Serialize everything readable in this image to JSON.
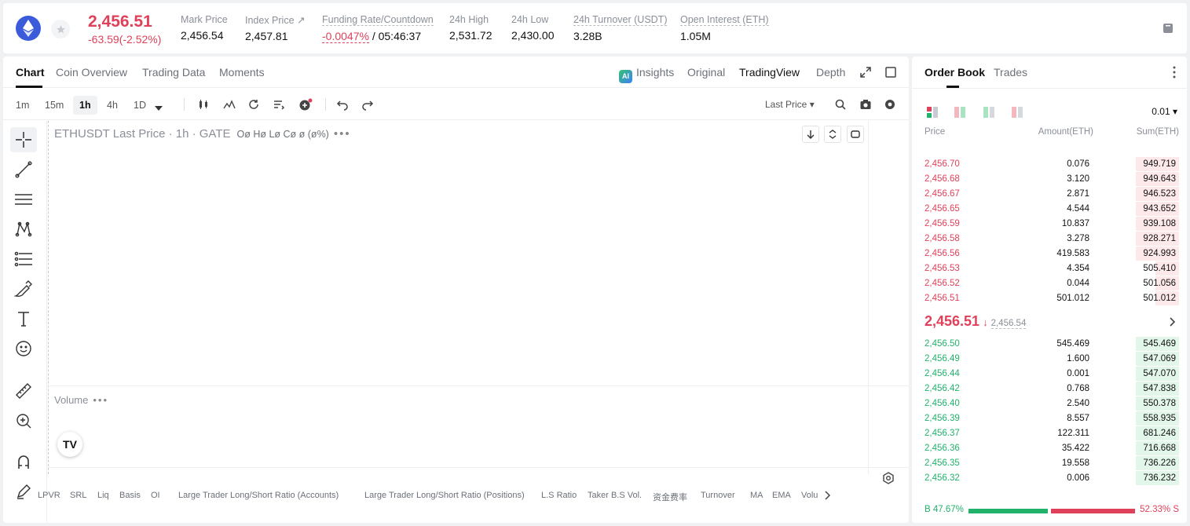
{
  "header": {
    "last_price": "2,456.51",
    "price_change": "-63.59(-2.52%)",
    "stats": [
      {
        "label": "Mark Price",
        "value": "2,456.54"
      },
      {
        "label": "Index Price ↗",
        "value": "2,457.81"
      },
      {
        "label": "Funding Rate/Countdown",
        "value": "-0.0047%",
        "countdown": "/ 05:46:37"
      },
      {
        "label": "24h High",
        "value": "2,531.72"
      },
      {
        "label": "24h Low",
        "value": "2,430.00"
      },
      {
        "label": "24h Turnover (USDT)",
        "value": "3.28B"
      },
      {
        "label": "Open Interest (ETH)",
        "value": "1.05M"
      }
    ]
  },
  "chart": {
    "tabs": [
      "Chart",
      "Coin Overview",
      "Trading Data",
      "Moments"
    ],
    "views": {
      "insights": "Insights",
      "ai_badge": "AI",
      "original": "Original",
      "tradingview": "TradingView",
      "depth": "Depth"
    },
    "intervals": [
      "1m",
      "15m",
      "1h",
      "4h",
      "1D"
    ],
    "price_source": "Last Price ▾",
    "legend": "ETHUSDT Last Price · 1h · GATE",
    "ohlc": "Oø Hø Lø Cø ø (ø%)",
    "dots": "•••",
    "volume_label": "Volume",
    "tv_logo": "TV",
    "indicators": [
      "LPVR",
      "SRL",
      "Liq",
      "Basis",
      "OI",
      "Large Trader Long/Short Ratio (Accounts)",
      "Large Trader Long/Short Ratio (Positions)",
      "L.S Ratio",
      "Taker B.S Vol.",
      "资金费率",
      "Turnover",
      "MA",
      "EMA",
      "Volu"
    ]
  },
  "orderbook": {
    "tabs": [
      "Order Book",
      "Trades"
    ],
    "precision": "0.01 ▾",
    "headers": {
      "price": "Price",
      "amount": "Amount(ETH)",
      "sum": "Sum(ETH)"
    },
    "asks": [
      {
        "price": "2,456.70",
        "amount": "0.076",
        "sum": "949.719",
        "depth": 0.55
      },
      {
        "price": "2,456.68",
        "amount": "3.120",
        "sum": "949.643",
        "depth": 0.55
      },
      {
        "price": "2,456.67",
        "amount": "2.871",
        "sum": "946.523",
        "depth": 0.55
      },
      {
        "price": "2,456.65",
        "amount": "4.544",
        "sum": "943.652",
        "depth": 0.55
      },
      {
        "price": "2,456.59",
        "amount": "10.837",
        "sum": "939.108",
        "depth": 0.55
      },
      {
        "price": "2,456.58",
        "amount": "3.278",
        "sum": "928.271",
        "depth": 0.55
      },
      {
        "price": "2,456.56",
        "amount": "419.583",
        "sum": "924.993",
        "depth": 0.55
      },
      {
        "price": "2,456.53",
        "amount": "4.354",
        "sum": "505.410",
        "depth": 0.3
      },
      {
        "price": "2,456.52",
        "amount": "0.044",
        "sum": "501.056",
        "depth": 0.3
      },
      {
        "price": "2,456.51",
        "amount": "501.012",
        "sum": "501.012",
        "depth": 0.3
      }
    ],
    "mid": {
      "price": "2,456.51",
      "arrow": "🡓",
      "mark": "2,456.54"
    },
    "bids": [
      {
        "price": "2,456.50",
        "amount": "545.469",
        "sum": "545.469",
        "depth": 0.55
      },
      {
        "price": "2,456.49",
        "amount": "1.600",
        "sum": "547.069",
        "depth": 0.55
      },
      {
        "price": "2,456.44",
        "amount": "0.001",
        "sum": "547.070",
        "depth": 0.55
      },
      {
        "price": "2,456.42",
        "amount": "0.768",
        "sum": "547.838",
        "depth": 0.55
      },
      {
        "price": "2,456.40",
        "amount": "2.540",
        "sum": "550.378",
        "depth": 0.55
      },
      {
        "price": "2,456.39",
        "amount": "8.557",
        "sum": "558.935",
        "depth": 0.55
      },
      {
        "price": "2,456.37",
        "amount": "122.311",
        "sum": "681.246",
        "depth": 0.55
      },
      {
        "price": "2,456.36",
        "amount": "35.422",
        "sum": "716.668",
        "depth": 0.55
      },
      {
        "price": "2,456.35",
        "amount": "19.558",
        "sum": "736.226",
        "depth": 0.55
      },
      {
        "price": "2,456.32",
        "amount": "0.006",
        "sum": "736.232",
        "depth": 0.55
      }
    ],
    "ratio": {
      "buy_label": "B 47.67%",
      "sell_label": "52.33% S",
      "buy": 0.4767,
      "sell": 0.5233
    },
    "colors": {
      "ask": "#e0415a",
      "bid": "#21b26c"
    }
  }
}
